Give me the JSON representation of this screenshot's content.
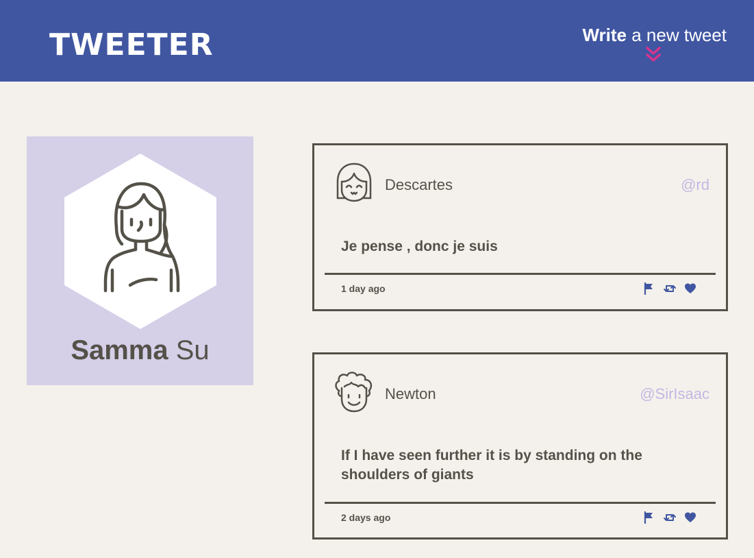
{
  "header": {
    "brand": "TWEETER",
    "compose_bold": "Write",
    "compose_rest": " a new tweet",
    "compose_icon": "double-chevron-down-icon"
  },
  "colors": {
    "nav_bg": "#4056a1",
    "page_bg": "#f4f1ec",
    "profile_bg": "#d5cfe8",
    "text": "#545149",
    "handle": "#c3b8e3",
    "icon_blue": "#4056a1",
    "accent": "#d9338f"
  },
  "profile": {
    "first_name": "Samma",
    "last_name": "Su",
    "avatar": "woman-avatar-icon"
  },
  "tweets": [
    {
      "avatar": "girl-face-icon",
      "name": "Descartes",
      "handle": "@rd",
      "text": "Je pense , donc je suis",
      "age": "1 day ago",
      "actions": [
        "flag-icon",
        "retweet-icon",
        "heart-icon"
      ]
    },
    {
      "avatar": "curly-hair-face-icon",
      "name": "Newton",
      "handle": "@SirIsaac",
      "text": "If I have seen further it is by standing on the shoulders of giants",
      "age": "2 days ago",
      "actions": [
        "flag-icon",
        "retweet-icon",
        "heart-icon"
      ]
    }
  ]
}
